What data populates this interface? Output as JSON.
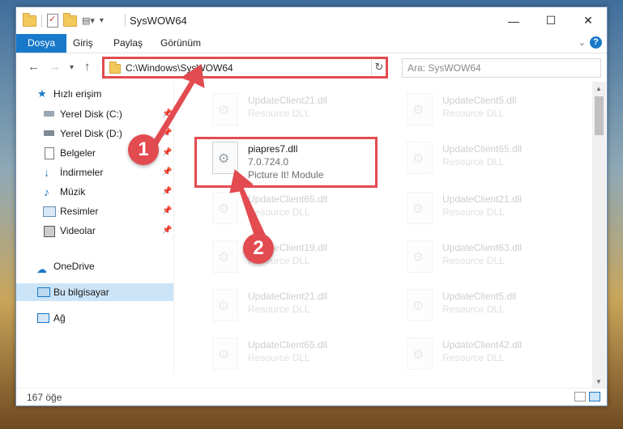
{
  "window": {
    "title": "SysWOW64",
    "minimize_glyph": "—",
    "maximize_glyph": "☐",
    "close_glyph": "✕"
  },
  "ribbon": {
    "tabs": [
      "Dosya",
      "Giriş",
      "Paylaş",
      "Görünüm"
    ],
    "help_glyph": "?"
  },
  "navbar": {
    "address": "C:\\Windows\\SysWOW64",
    "search_placeholder": "Ara: SysWOW64"
  },
  "navpane": {
    "quick_access": "Hızlı erişim",
    "items": [
      {
        "label": "Yerel Disk (C:)",
        "icon": "drive-icon"
      },
      {
        "label": "Yerel Disk (D:)",
        "icon": "drive-icon"
      },
      {
        "label": "Belgeler",
        "icon": "documents-icon"
      },
      {
        "label": "İndirmeler",
        "icon": "downloads-icon"
      },
      {
        "label": "Müzik",
        "icon": "music-icon"
      },
      {
        "label": "Resimler",
        "icon": "pictures-icon"
      },
      {
        "label": "Videolar",
        "icon": "videos-icon"
      }
    ],
    "onedrive": "OneDrive",
    "this_pc": "Bu bilgisayar",
    "network": "Ağ"
  },
  "files": {
    "highlighted": {
      "name": "piapres7.dll",
      "version": "7.0.724.0",
      "description": "Picture It! Module"
    },
    "ghost": [
      {
        "name": "UpdateClient21.dll",
        "type": "Resource DLL"
      },
      {
        "name": "UpdateClient5.dll",
        "type": "Resource DLL"
      },
      {
        "name": "UpdateClient65.dll",
        "type": "Resource DLL"
      },
      {
        "name": "UpdateClient65.dll",
        "type": "Resource DLL"
      },
      {
        "name": "UpdateClient21.dll",
        "type": "Resource DLL"
      },
      {
        "name": "UpdateClient19.dll",
        "type": "Resource DLL"
      },
      {
        "name": "UpdateClient63.dll",
        "type": "Resource DLL"
      },
      {
        "name": "UpdateClient21.dll",
        "type": "Resource DLL"
      },
      {
        "name": "UpdateClient5.dll",
        "type": "Resource DLL"
      },
      {
        "name": "UpdateClient65.dll",
        "type": "Resource DLL"
      },
      {
        "name": "UpdateClient42.dll",
        "type": "Resource DLL"
      }
    ]
  },
  "status": {
    "count": "167 öğe"
  },
  "annotations": {
    "step1": "1",
    "step2": "2",
    "color": "#e24b50"
  }
}
